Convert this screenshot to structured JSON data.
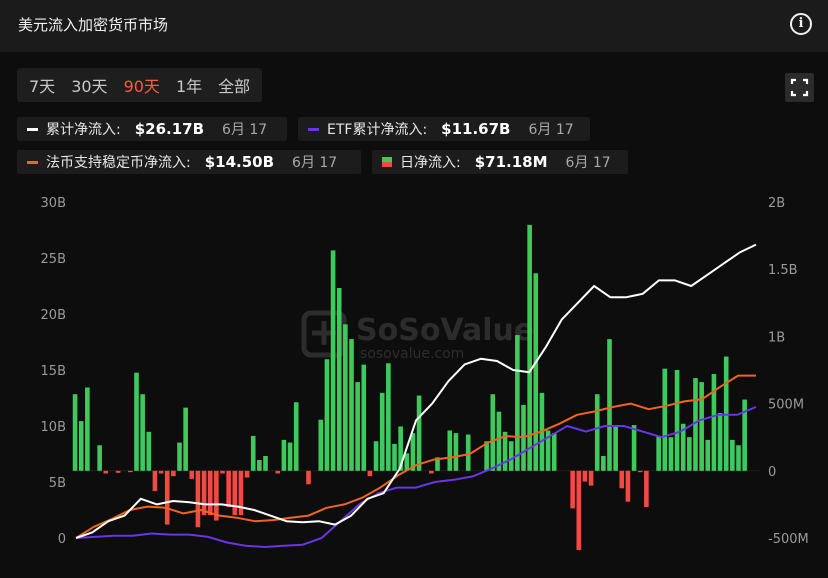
{
  "header": {
    "title": "美元流入加密货币市场"
  },
  "range_tabs": [
    {
      "label": "7天",
      "active": false
    },
    {
      "label": "30天",
      "active": false
    },
    {
      "label": "90天",
      "active": true
    },
    {
      "label": "1年",
      "active": false
    },
    {
      "label": "全部",
      "active": false
    }
  ],
  "legend": {
    "cumulative": {
      "label": "累计净流入:",
      "value": "$26.17B",
      "date": "6月 17",
      "color": "#ffffff"
    },
    "etf": {
      "label": "ETF累计净流入:",
      "value": "$11.67B",
      "date": "6月 17",
      "color": "#6a35e8"
    },
    "stablecoin": {
      "label": "法币支持稳定币净流入:",
      "value": "$14.50B",
      "date": "6月 17",
      "color": "#f0641e"
    },
    "daily": {
      "label": "日净流入:",
      "value": "$71.18M",
      "date": "6月 17",
      "color_pos": "#3ec95c",
      "color_neg": "#f24a43"
    }
  },
  "watermark": {
    "brand": "SoSoValue",
    "url": "sosovalue.com"
  },
  "chart_data": {
    "type": "bar",
    "left_axis": {
      "ticks": [
        "0",
        "5B",
        "10B",
        "15B",
        "20B",
        "25B",
        "30B"
      ],
      "range": [
        0,
        30
      ]
    },
    "right_axis": {
      "ticks": [
        "-500M",
        "0",
        "500M",
        "1B",
        "1.5B",
        "2B"
      ],
      "range": [
        -500,
        2000
      ]
    },
    "series": [
      {
        "name": "日净流入",
        "type": "bar",
        "axis": "right",
        "values": [
          570,
          370,
          620,
          0,
          190,
          -20,
          0,
          -15,
          0,
          -10,
          730,
          570,
          290,
          -150,
          -20,
          -400,
          -40,
          210,
          470,
          -60,
          -420,
          -330,
          -330,
          -370,
          -20,
          -270,
          -330,
          -330,
          -50,
          260,
          80,
          110,
          0,
          -20,
          230,
          210,
          510,
          0,
          -100,
          0,
          380,
          830,
          1640,
          1360,
          1090,
          980,
          660,
          790,
          -40,
          220,
          580,
          800,
          200,
          330,
          130,
          280,
          560,
          0,
          -20,
          100,
          0,
          300,
          280,
          0,
          270,
          0,
          0,
          220,
          570,
          440,
          290,
          220,
          1010,
          490,
          1830,
          1470,
          580,
          300,
          280,
          0,
          0,
          -280,
          -590,
          -80,
          -110,
          570,
          110,
          980,
          330,
          -130,
          -230,
          340,
          -10,
          -270,
          0,
          260,
          760,
          250,
          750,
          350,
          250,
          690,
          660,
          230,
          720,
          430,
          850,
          230,
          190,
          530,
          0,
          0
        ]
      },
      {
        "name": "累计净流入",
        "type": "line",
        "axis": "left",
        "values": [
          0,
          0.5,
          1.5,
          2.0,
          3.5,
          3.0,
          3.3,
          3.2,
          3.0,
          3.0,
          2.8,
          2.5,
          2.0,
          1.5,
          1.4,
          1.5,
          1.2,
          2.0,
          3.5,
          4.0,
          6.2,
          10.5,
          12.0,
          14.0,
          15.5,
          16.0,
          15.8,
          15.0,
          14.8,
          17.0,
          19.5,
          21.0,
          22.5,
          21.5,
          21.5,
          21.8,
          23.0,
          23.0,
          22.5,
          23.5,
          24.5,
          25.5,
          26.2
        ]
      },
      {
        "name": "ETF累计净流入",
        "type": "line",
        "axis": "left",
        "values": [
          0,
          0.1,
          0.2,
          0.2,
          0.4,
          0.3,
          0.3,
          0.1,
          -0.4,
          -0.7,
          -0.8,
          -0.7,
          -0.6,
          0,
          1.5,
          3.0,
          4.0,
          4.5,
          4.5,
          5.0,
          5.2,
          5.5,
          6.2,
          7.0,
          8.0,
          9.0,
          10.0,
          9.5,
          10.0,
          10.0,
          9.5,
          9.0,
          9.5,
          10.5,
          11.0,
          11.0,
          11.7
        ]
      },
      {
        "name": "法币支持稳定币净流入",
        "type": "line",
        "axis": "left",
        "values": [
          0,
          1.0,
          1.7,
          2.5,
          2.8,
          2.7,
          2.2,
          2.5,
          2.0,
          1.8,
          1.5,
          1.6,
          1.8,
          2.0,
          2.7,
          3.0,
          3.6,
          4.5,
          5.6,
          6.5,
          7.0,
          7.2,
          7.5,
          8.5,
          9.1,
          9.0,
          9.5,
          10.2,
          11.0,
          11.3,
          11.7,
          12.0,
          11.5,
          11.8,
          12.2,
          12.4,
          13.5,
          14.5,
          14.5
        ]
      }
    ]
  }
}
